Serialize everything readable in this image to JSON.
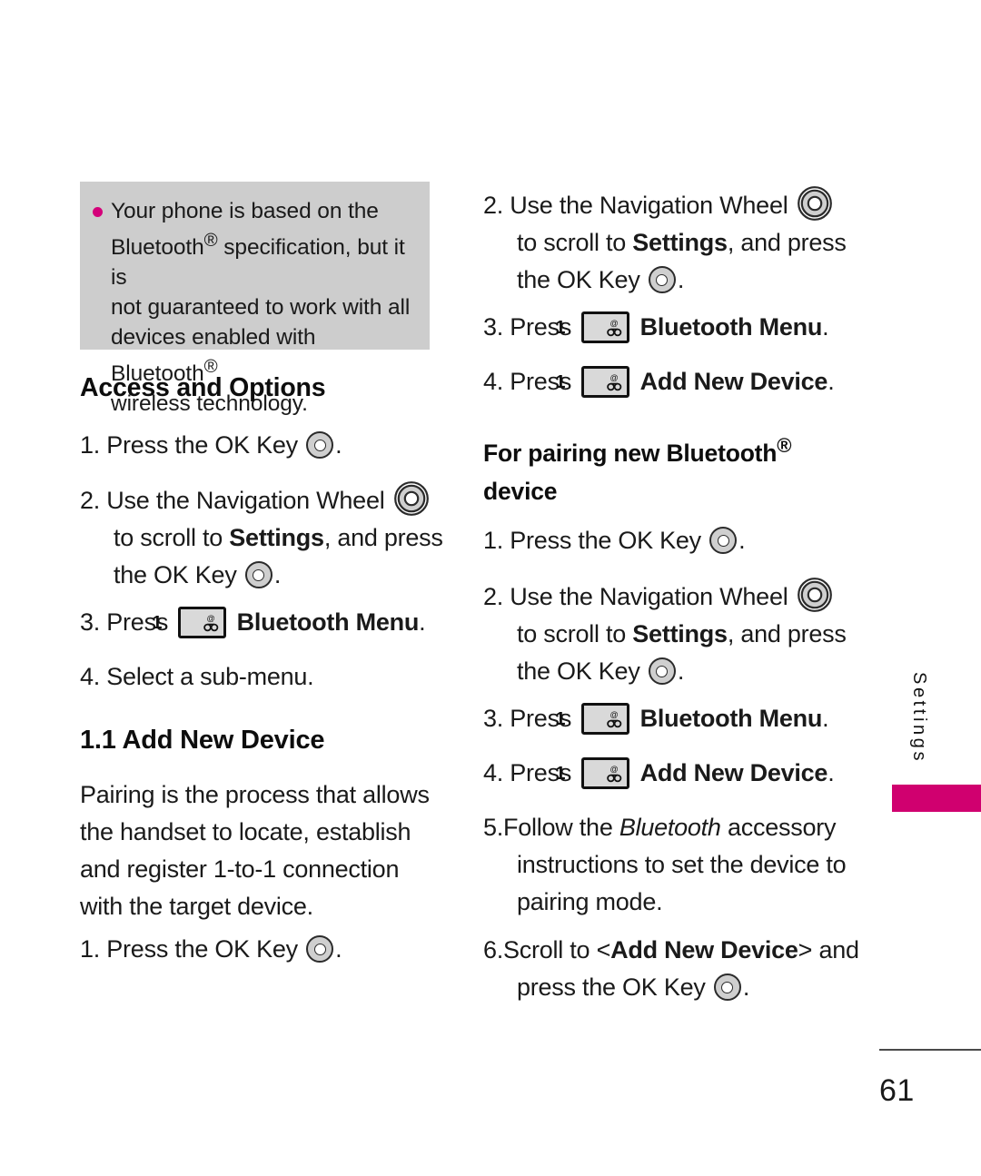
{
  "note": {
    "bullet_color": "#d4007a",
    "background": "#cdcdcd",
    "text_line1": "Your phone is based on the",
    "text_line2_a": "Bluetooth",
    "text_line2_reg": "®",
    "text_line2_b": " specification, but it is",
    "text_line3": "not guaranteed to work with all",
    "text_line4_a": "devices enabled with Bluetooth",
    "text_line4_reg": "®",
    "text_line5": "wireless technology."
  },
  "left_column": {
    "heading_access": "Access and Options",
    "step1_num": "1.",
    "step1_a": "Press the OK Key",
    "step1_b": ".",
    "step2_num": "2.",
    "step2_a": "Use the Navigation Wheel",
    "step2_b": "to scroll to ",
    "step2_bold": "Settings",
    "step2_c": ", and press the OK Key",
    "step2_d": ".",
    "step3_num": "3.",
    "step3_a": "Press",
    "step3_bold": "Bluetooth Menu",
    "step3_b": ".",
    "step4_num": "4.",
    "step4_a": "Select a sub-menu.",
    "heading_add_new_device": "1.1 Add New Device",
    "para_pairing": "Pairing is the process that allows the handset to locate, establish and register 1-to-1 connection with the target device.",
    "step5_num": "1.",
    "step5_a": "Press the OK Key",
    "step5_b": "."
  },
  "right_column": {
    "step2_num": "2.",
    "step2_a": "Use the Navigation Wheel",
    "step2_b": "to scroll to ",
    "step2_bold": "Settings",
    "step2_c": ", and press the OK Key",
    "step2_d": ".",
    "step3_num": "3.",
    "step3_a": "Press",
    "step3_bold": "Bluetooth Menu",
    "step3_b": ".",
    "step4_num": "4.",
    "step4_a": "Press",
    "step4_bold": "Add New Device",
    "step4_b": ".",
    "heading_pairing_a": "For pairing new Bluetooth",
    "heading_pairing_reg": "®",
    "heading_pairing_b": "device",
    "p1_num": "1.",
    "p1_a": "Press the OK Key",
    "p1_b": ".",
    "p2_num": "2.",
    "p2_a": "Use the Navigation Wheel",
    "p2_b": "to scroll to ",
    "p2_bold": "Settings",
    "p2_c": ", and press the OK Key",
    "p2_d": ".",
    "p3_num": "3.",
    "p3_a": "Press",
    "p3_bold": "Bluetooth Menu",
    "p3_b": ".",
    "p4_num": "4.",
    "p4_a": "Press",
    "p4_bold": "Add New Device",
    "p4_b": ".",
    "p5_num": "5.",
    "p5_a": "Follow the ",
    "p5_ital": "Bluetooth",
    "p5_b": " accessory instructions to set the device to pairing mode.",
    "p6_num": "6.",
    "p6_a": "Scroll to <",
    "p6_bold": "Add New Device",
    "p6_b": "> and press the OK Key",
    "p6_c": "."
  },
  "side_tab": {
    "label": "Settings",
    "bar_color": "#d0006f"
  },
  "footer": {
    "page_number": "61"
  },
  "icons": {
    "ok_key": "ok-key-icon",
    "navigation_wheel": "navigation-wheel-icon",
    "number_one_key": "number-one-key-icon",
    "note_bullet": "bullet-icon"
  }
}
